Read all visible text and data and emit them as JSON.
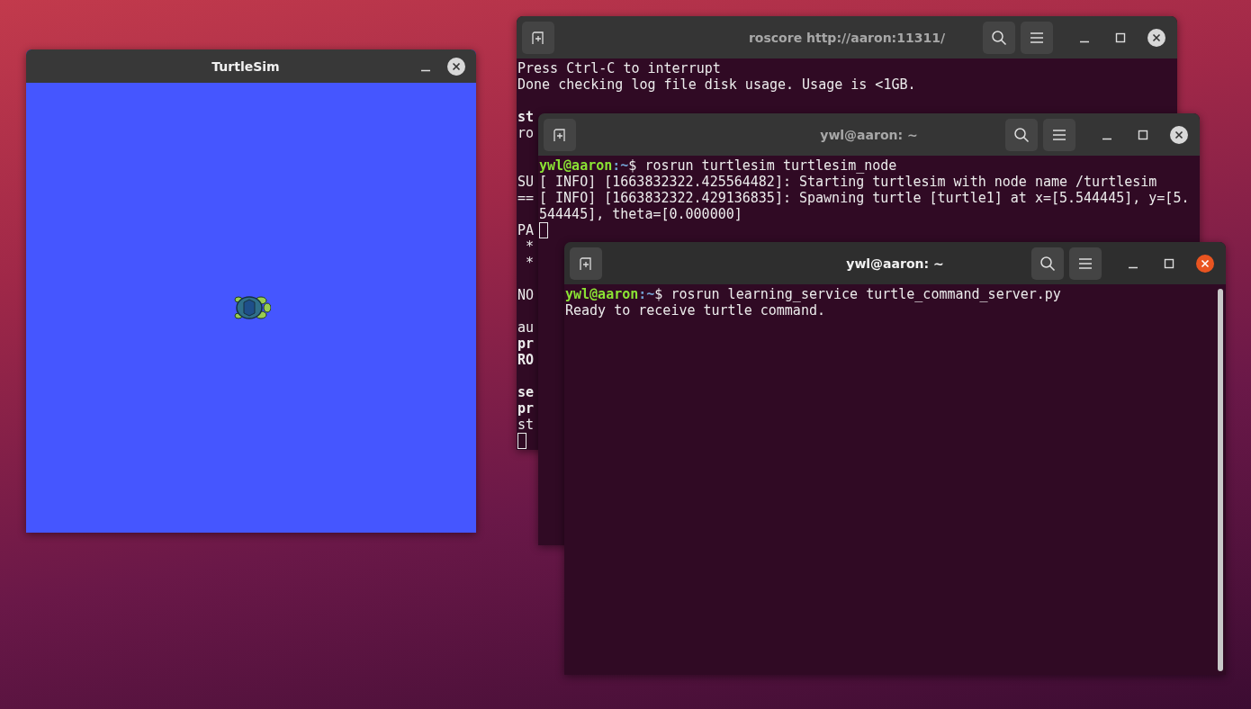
{
  "windows": [
    {
      "kind": "turtlesim",
      "title": "TurtleSim",
      "focused": false
    },
    {
      "kind": "terminal",
      "title": "roscore http://aaron:11311/",
      "focused": false,
      "lines": [
        {
          "kind": "plain",
          "text": "Press Ctrl-C to interrupt"
        },
        {
          "kind": "plain",
          "text": "Done checking log file disk usage. Usage is <1GB."
        },
        {
          "kind": "blank"
        },
        {
          "kind": "bold",
          "text": "st"
        },
        {
          "kind": "plain",
          "text": "ro"
        },
        {
          "kind": "blank"
        },
        {
          "kind": "blank"
        },
        {
          "kind": "plain",
          "text": "SU"
        },
        {
          "kind": "plain",
          "text": "=="
        },
        {
          "kind": "blank"
        },
        {
          "kind": "plain",
          "text": "PA"
        },
        {
          "kind": "plain",
          "text": " *"
        },
        {
          "kind": "plain",
          "text": " *"
        },
        {
          "kind": "blank"
        },
        {
          "kind": "plain",
          "text": "NO"
        },
        {
          "kind": "blank"
        },
        {
          "kind": "plain",
          "text": "au"
        },
        {
          "kind": "bold",
          "text": "pr"
        },
        {
          "kind": "bold",
          "text": "RO"
        },
        {
          "kind": "blank"
        },
        {
          "kind": "bold",
          "text": "se"
        },
        {
          "kind": "bold",
          "text": "pr"
        },
        {
          "kind": "plain",
          "text": "st"
        },
        {
          "kind": "cursor"
        }
      ]
    },
    {
      "kind": "terminal",
      "title": "ywl@aaron: ~",
      "focused": false,
      "lines": [
        {
          "kind": "prompt",
          "user_host": "ywl@aaron",
          "path": ":~",
          "command": "$ rosrun turtlesim turtlesim_node"
        },
        {
          "kind": "plain",
          "text": "[ INFO] [1663832322.425564482]: Starting turtlesim with node name /turtlesim"
        },
        {
          "kind": "plain",
          "text": "[ INFO] [1663832322.429136835]: Spawning turtle [turtle1] at x=[5.544445], y=[5."
        },
        {
          "kind": "plain",
          "text": "544445], theta=[0.000000]"
        },
        {
          "kind": "cursor"
        }
      ]
    },
    {
      "kind": "terminal",
      "title": "ywl@aaron: ~",
      "focused": true,
      "lines": [
        {
          "kind": "prompt",
          "user_host": "ywl@aaron",
          "path": ":~",
          "command": "$ rosrun learning_service turtle_command_server.py"
        },
        {
          "kind": "plain",
          "text": "Ready to receive turtle command."
        }
      ]
    }
  ]
}
